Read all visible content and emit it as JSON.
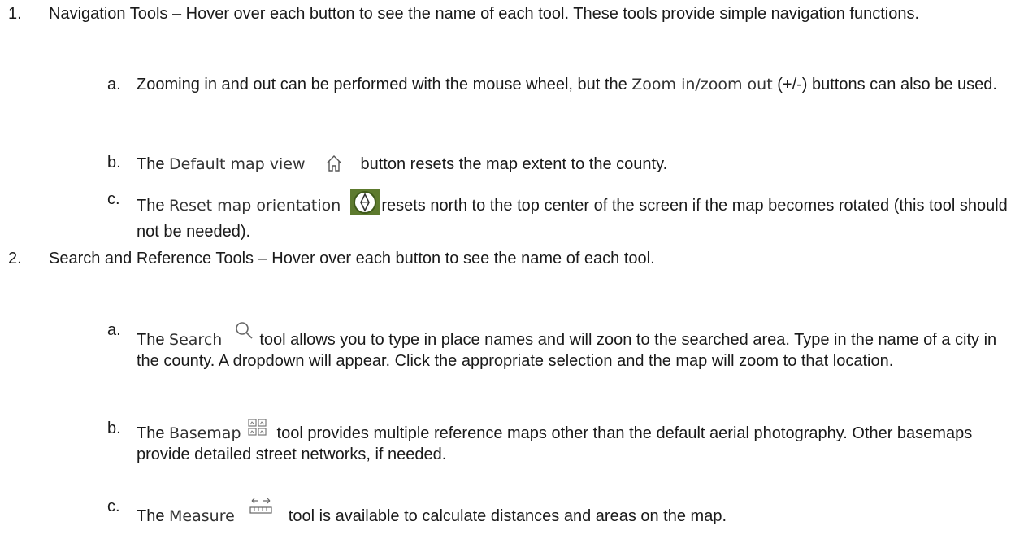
{
  "items": [
    {
      "number": "1.",
      "text": "Navigation Tools – Hover over each button to see the name of each tool. These tools provide simple navigation functions.",
      "subitems": [
        {
          "letter": "a.",
          "pre": "Zooming in and out can be performed with the mouse wheel, but the ",
          "tool": "Zoom in/zoom out",
          "post": " (+/-) buttons can also be used."
        },
        {
          "letter": "b.",
          "pre": "The ",
          "tool": "Default map view",
          "icon": "home-icon",
          "post": "button resets the map extent to the county."
        },
        {
          "letter": "c.",
          "pre": "The ",
          "tool": "Reset map orientation",
          "icon": "compass-icon",
          "post": "resets north to the top center of the screen if the map becomes rotated (this tool should not be needed)."
        }
      ]
    },
    {
      "number": "2.",
      "text": "Search and Reference Tools – Hover over each button to see the name of each tool.",
      "subitems": [
        {
          "letter": "a.",
          "pre": "The ",
          "tool": "Search",
          "icon": "search-icon",
          "post": "tool allows you to type in place names and will zoon to the searched area. Type in the name of a city in the county. A dropdown will appear. Click the appropriate selection and the map will zoom to that location."
        },
        {
          "letter": "b.",
          "pre": "The ",
          "tool": "Basemap",
          "icon": "basemap-gallery-icon",
          "post": "tool provides multiple reference maps other than the default aerial photography. Other basemaps provide detailed street networks, if needed."
        },
        {
          "letter": "c.",
          "pre": "The ",
          "tool": "Measure",
          "icon": "measure-icon",
          "post": "tool is available to calculate distances and areas on the map."
        }
      ]
    }
  ]
}
